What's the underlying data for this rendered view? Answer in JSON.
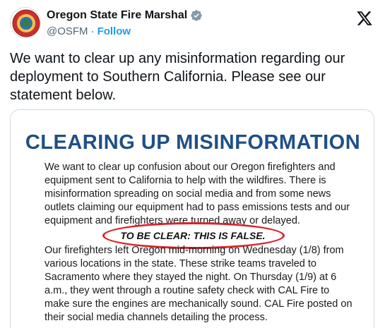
{
  "account": {
    "display_name": "Oregon State Fire Marshal",
    "handle": "@OSFM",
    "separator": "·",
    "follow_label": "Follow",
    "verified_color": "#829aab"
  },
  "tweet": {
    "text": "We want to clear up any misinformation regarding our deployment to Southern California. Please see our statement below."
  },
  "media": {
    "heading": "CLEARING UP MISINFORMATION",
    "paragraph_1": "We want to clear up confusion about our Oregon firefighters and equipment sent to California to help with the wildfires. There is misinformation spreading on social media and from some news outlets claiming our equipment had to pass emissions tests and our equipment and firefighters were turned away or delayed.",
    "emphasis": "TO BE CLEAR: THIS IS FALSE.",
    "paragraph_2": "Our firefighters left Oregon mid-morning on Wednesday (1/8) from various locations in the state. These strike teams traveled to Sacramento where they stayed the night. On Thursday (1/9) at 6 a.m., they went through a routine safety check with CAL Fire to make sure the engines are mechanically sound. CAL Fire posted on their social media channels detailing the process.",
    "heading_color": "#1f4f87",
    "annotation_color": "#d8222a"
  },
  "icons": {
    "avatar": "osfm-seal-icon",
    "verified": "verified-badge-icon",
    "platform": "x-logo-icon"
  }
}
